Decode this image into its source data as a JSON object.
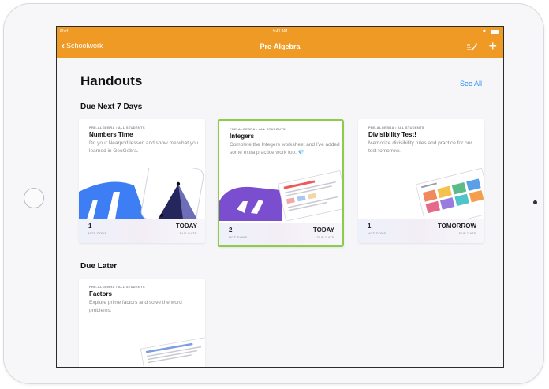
{
  "status_bar": {
    "device": "iPad",
    "time": "9:41 AM"
  },
  "nav": {
    "back_label": "Schoolwork",
    "title": "Pre-Algebra"
  },
  "header": {
    "title": "Handouts",
    "see_all": "See All"
  },
  "sections": [
    {
      "title": "Due Next 7 Days",
      "cards": [
        {
          "kicker": "PRE-ALGEBRA • ALL STUDENTS",
          "title": "Numbers Time",
          "description": "Do your Nearpod lesson and show me what you learned in GeoGebra.",
          "count": "1",
          "status": "NOT DONE",
          "due": "TODAY",
          "due_label": "DUE DATE"
        },
        {
          "kicker": "PRE-ALGEBRA • ALL STUDENTS",
          "title": "Integers",
          "description": "Complete the Integers worksheet and I've added some extra practice work too. 💎",
          "count": "2",
          "status": "NOT DONE",
          "due": "TODAY",
          "due_label": "DUE DATE"
        },
        {
          "kicker": "PRE-ALGEBRA • ALL STUDENTS",
          "title": "Divisibility Test!",
          "description": "Memorize divisibility rules and practice for our test tomorrow.",
          "count": "1",
          "status": "NOT DONE",
          "due": "TOMORROW",
          "due_label": "DUE DATE"
        }
      ]
    },
    {
      "title": "Due Later",
      "cards": [
        {
          "kicker": "PRE-ALGEBRA • ALL STUDENTS",
          "title": "Factors",
          "description": "Explore prime factors and solve the word problems."
        }
      ]
    }
  ],
  "colors": {
    "accent": "#ef9a24",
    "link": "#2a8cf0",
    "selection": "#8ccc4a"
  }
}
